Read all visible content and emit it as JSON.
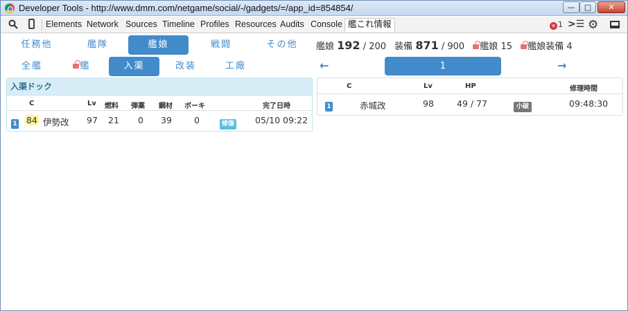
{
  "window": {
    "title": "Developer Tools - http://www.dmm.com/netgame/social/-/gadgets/=/app_id=854854/",
    "min": "—",
    "max": "□",
    "close": "✕"
  },
  "devtools": {
    "tabs": [
      "Elements",
      "Network",
      "Sources",
      "Timeline",
      "Profiles",
      "Resources",
      "Audits",
      "Console",
      "艦これ情報"
    ],
    "active_tab": "艦これ情報",
    "error_count": "1",
    "icons": [
      "search-icon",
      "device-icon",
      "error-icon",
      "console-drawer-icon",
      "gear-icon",
      "dock-icon"
    ]
  },
  "nav_primary": [
    "任務他",
    "艦隊",
    "艦娘",
    "戦闘",
    "その他"
  ],
  "nav_primary_active": "艦娘",
  "nav_secondary": [
    "全艦",
    "艦",
    "入渠",
    "改装",
    "工廠"
  ],
  "nav_secondary_active": "入渠",
  "stats": {
    "ship_label": "艦娘",
    "ship_count": "192",
    "ship_max": "/ 200",
    "equip_label": "装備",
    "equip_count": "871",
    "equip_max": "/ 900",
    "locked_ship_label": "艦娘",
    "locked_ship_count": "15",
    "locked_equip_label": "艦娘装備",
    "locked_equip_count": "4"
  },
  "pager": {
    "page": "1",
    "prev": "🡐",
    "next": "🡒"
  },
  "dock": {
    "title": "入渠ドック",
    "headers": [
      "C",
      "Lv",
      "燃料",
      "弾薬",
      "鋼材",
      "ボーキ",
      "完了日時"
    ],
    "rows": [
      {
        "no": "1",
        "lv": "84",
        "name": "伊勢改",
        "ship_lv": "97",
        "fuel": "21",
        "ammo": "0",
        "steel": "39",
        "bauxite": "0",
        "status": "修復",
        "done": "05/10 09:22"
      }
    ]
  },
  "repair": {
    "headers": [
      "C",
      "Lv",
      "HP",
      "修理時間"
    ],
    "rows": [
      {
        "no": "1",
        "name": "赤城改",
        "lv": "98",
        "hp": "49 / 77",
        "damage": "小破",
        "time": "09:48:30"
      }
    ]
  },
  "colors": {
    "accent": "#428bca",
    "panel_head_bg": "#d9edf7",
    "panel_head_text": "#31708f",
    "lock": "#e57373",
    "heal_badge": "#5bc0de",
    "damage_badge": "#777777",
    "level_highlight": "#fff59d"
  }
}
